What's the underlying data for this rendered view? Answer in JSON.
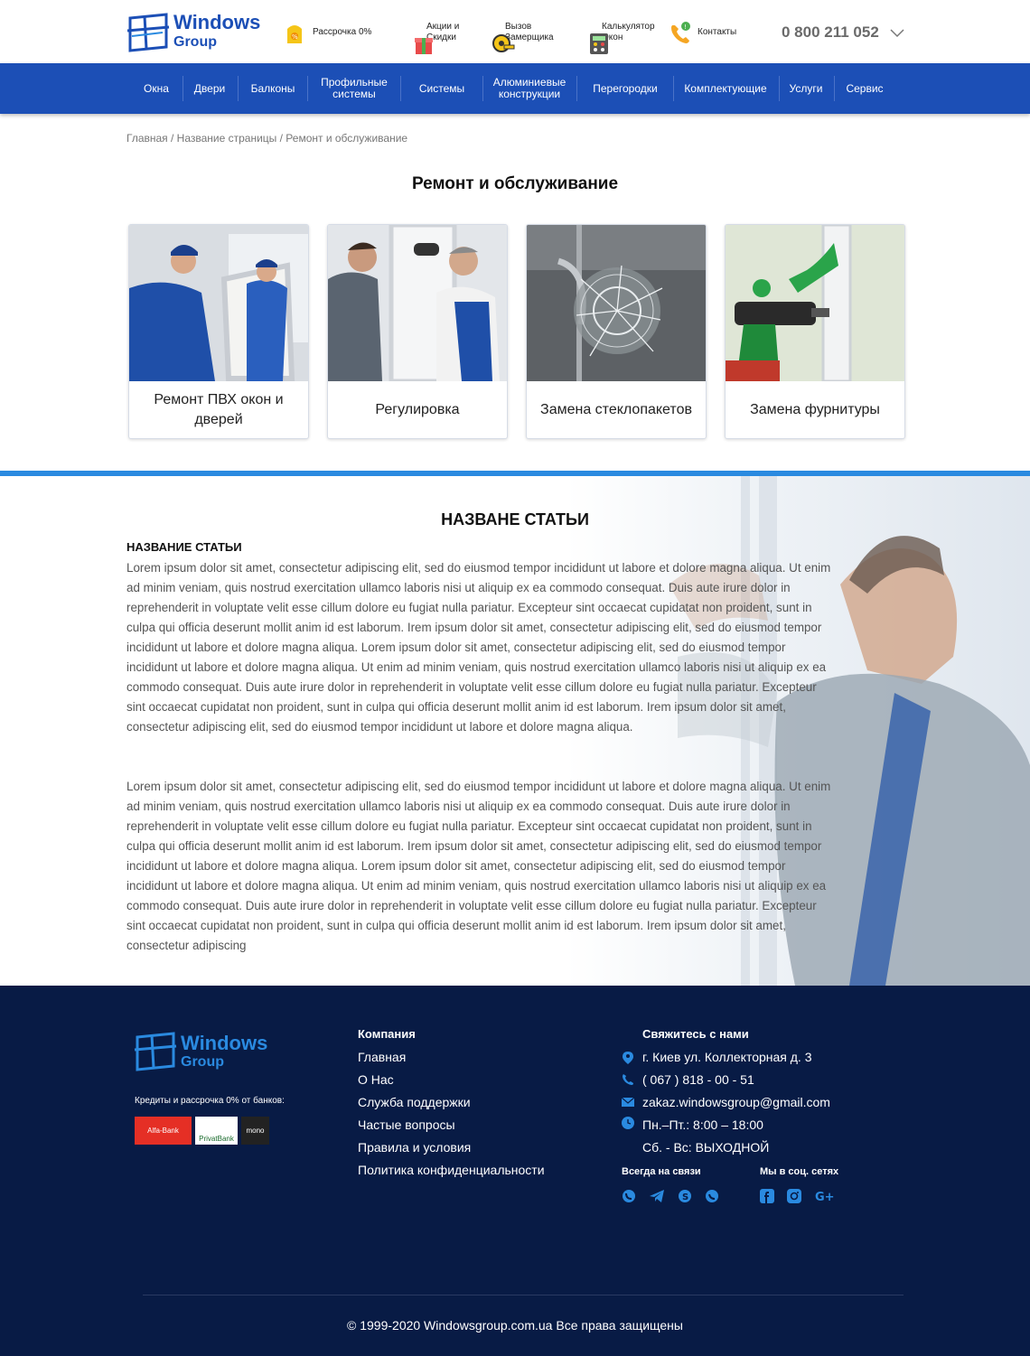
{
  "header": {
    "logo": {
      "line1": "Windows",
      "line2": "Group"
    },
    "links": [
      {
        "label": "Рассрочка 0%",
        "icon": "installment-icon"
      },
      {
        "label": "Акции и\nСкидки",
        "icon": "gift-icon"
      },
      {
        "label": "Вызов\nЗамерщика",
        "icon": "tape-measure-icon"
      },
      {
        "label": "Калькулятор\nОкон",
        "icon": "calculator-icon"
      },
      {
        "label": "Контакты",
        "icon": "phone-icon"
      }
    ],
    "phone": "0 800 211 052"
  },
  "nav": {
    "items": [
      "Окна",
      "Двери",
      "Балконы",
      "Профильные\nсистемы",
      "Системы",
      "Алюминиевые\nконструкции",
      "Перегородки",
      "Комплектующие",
      "Услуги",
      "Сервис"
    ]
  },
  "breadcrumb": "Главная / Название страницы / Ремонт и обслуживание",
  "page_title": "Ремонт и обслуживание",
  "cards": [
    {
      "caption": "Ремонт ПВХ окон и дверей"
    },
    {
      "caption": "Регулировка"
    },
    {
      "caption": "Замена стеклопакетов"
    },
    {
      "caption": "Замена фурнитуры"
    }
  ],
  "article": {
    "title": "НАЗВАНЕ СТАТЬИ",
    "subtitle": "НАЗВАНИЕ СТАТЬИ",
    "p1": "Lorem ipsum dolor sit amet, consectetur adipiscing elit, sed do eiusmod tempor incididunt ut labore et dolore magna aliqua. Ut enim ad minim veniam, quis nostrud exercitation ullamco laboris nisi ut aliquip ex ea commodo consequat. Duis aute irure dolor in reprehenderit in voluptate velit esse cillum dolore eu fugiat nulla pariatur. Excepteur sint occaecat cupidatat non proident, sunt in culpa qui officia deserunt mollit anim id est laborum. Irem ipsum dolor sit amet, consectetur adipiscing elit, sed do eiusmod tempor incididunt ut labore et dolore magna aliqua. Lorem ipsum dolor sit amet, consectetur adipiscing elit, sed do eiusmod tempor incididunt ut labore et dolore magna aliqua. Ut enim ad minim veniam, quis nostrud exercitation ullamco laboris nisi ut aliquip ex ea commodo consequat. Duis aute irure dolor in reprehenderit in voluptate velit esse cillum dolore eu fugiat nulla pariatur. Excepteur sint occaecat cupidatat non proident, sunt in culpa qui officia deserunt mollit anim id est laborum. Irem ipsum dolor sit amet, consectetur adipiscing elit, sed do eiusmod tempor incididunt ut labore et dolore magna aliqua.",
    "p2": "Lorem ipsum dolor sit amet, consectetur adipiscing elit, sed do eiusmod tempor incididunt ut labore et dolore magna aliqua. Ut enim ad minim veniam, quis nostrud exercitation ullamco laboris nisi ut aliquip ex ea commodo consequat. Duis aute irure dolor in reprehenderit in voluptate velit esse cillum dolore eu fugiat nulla pariatur. Excepteur sint occaecat cupidatat non proident, sunt in culpa qui officia deserunt mollit anim id est laborum. Irem ipsum dolor sit amet, consectetur adipiscing elit, sed do eiusmod tempor incididunt ut labore et dolore magna aliqua. Lorem ipsum dolor sit amet, consectetur adipiscing elit, sed do eiusmod tempor incididunt ut labore et dolore magna aliqua. Ut enim ad minim veniam, quis nostrud exercitation ullamco laboris nisi ut aliquip ex ea commodo consequat. Duis aute irure dolor in reprehenderit in voluptate velit esse cillum dolore eu fugiat nulla pariatur. Excepteur sint occaecat cupidatat non proident, sunt in culpa qui officia deserunt mollit anim id est laborum. Irem ipsum dolor sit amet, consectetur adipiscing"
  },
  "footer": {
    "logo": {
      "line1": "Windows",
      "line2": "Group"
    },
    "credit_text": "Кредиты и рассрочка  0% от банков:",
    "banks": [
      "Alfa-Bank",
      "PrivatBank",
      "mono"
    ],
    "company": {
      "heading": "Компания",
      "links": [
        "Главная",
        "О Нас",
        "Служба поддержки",
        "Частые вопросы",
        "Правила и условия",
        "Политика конфиденциальности"
      ]
    },
    "contacts": {
      "heading": "Свяжитесь с нами",
      "address": "г. Киев  ул. Коллекторная д. 3",
      "phone": "( 067 ) 818 - 00 - 51",
      "email": "zakaz.windowsgroup@gmail.com",
      "hours1": "Пн.–Пт.: 8:00 – 18:00",
      "hours2": "Сб. - Вс: ВЫХОДНОЙ"
    },
    "messengers_heading": "Всегда на связи",
    "social_heading": "Мы в соц. сетях",
    "messengers": [
      "viber-icon",
      "telegram-icon",
      "skype-icon",
      "whatsapp-icon"
    ],
    "social": [
      "facebook-icon",
      "instagram-icon",
      "google-plus-icon"
    ],
    "copyright": "© 1999-2020 Windowsgroup.com.ua Все права защищены"
  },
  "colors": {
    "brand": "#1c4fb6",
    "accent": "#2a8ae0",
    "footer": "#081b45"
  }
}
